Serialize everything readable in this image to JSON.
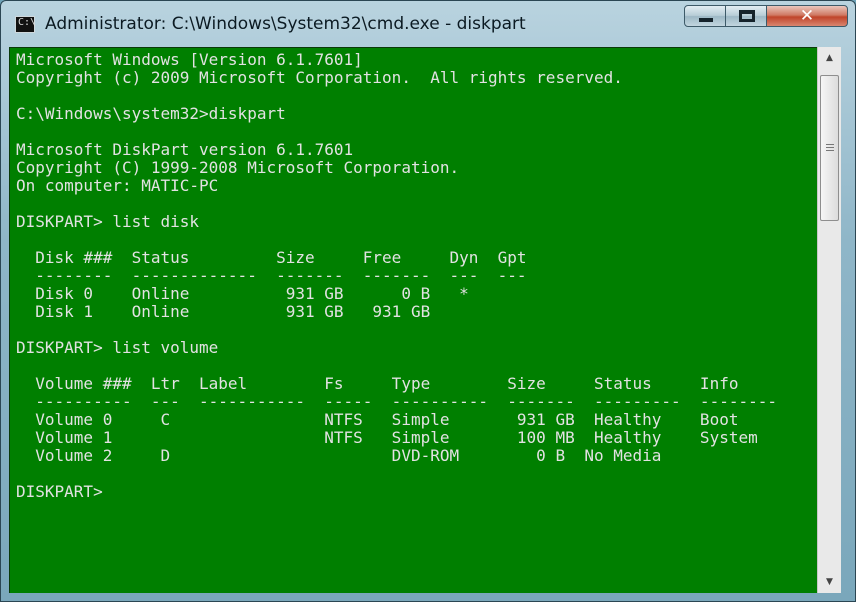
{
  "window": {
    "title": "Administrator: C:\\Windows\\System32\\cmd.exe - diskpart",
    "icon": "cmd-icon",
    "icon_glyph": "C:\\",
    "controls": {
      "minimize_icon": "minimize-icon",
      "maximize_icon": "maximize-icon",
      "close_glyph": "✕"
    }
  },
  "console": {
    "background": "#007f00",
    "foreground": "#e2e2e2",
    "lines": [
      "Microsoft Windows [Version 6.1.7601]",
      "Copyright (c) 2009 Microsoft Corporation.  All rights reserved.",
      "",
      "C:\\Windows\\system32>diskpart",
      "",
      "Microsoft DiskPart version 6.1.7601",
      "Copyright (C) 1999-2008 Microsoft Corporation.",
      "On computer: MATIC-PC",
      "",
      "DISKPART> list disk",
      "",
      "  Disk ###  Status         Size     Free     Dyn  Gpt",
      "  --------  -------------  -------  -------  ---  ---",
      "  Disk 0    Online          931 GB      0 B   *",
      "  Disk 1    Online          931 GB   931 GB",
      "",
      "DISKPART> list volume",
      "",
      "  Volume ###  Ltr  Label        Fs     Type        Size     Status     Info",
      "  ----------  ---  -----------  -----  ----------  -------  ---------  --------",
      "  Volume 0     C                NTFS   Simple       931 GB  Healthy    Boot",
      "  Volume 1                      NTFS   Simple       100 MB  Healthy    System",
      "  Volume 2     D                       DVD-ROM        0 B  No Media",
      "",
      "DISKPART>"
    ]
  },
  "scrollbar": {
    "up_arrow": "▲",
    "down_arrow": "▼"
  }
}
